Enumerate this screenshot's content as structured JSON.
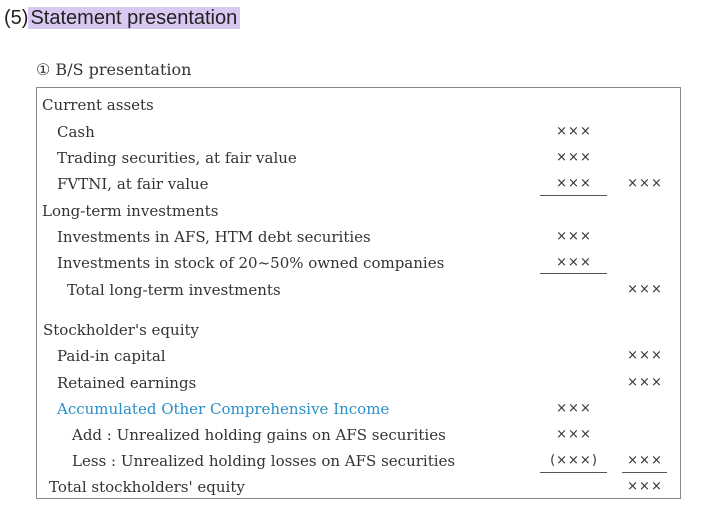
{
  "section": {
    "number": "(5)",
    "title": "Statement presentation"
  },
  "subtitle": "① B/S presentation",
  "rows": [
    {
      "label": "Current assets",
      "indent": 0,
      "col1": "",
      "col2": ""
    },
    {
      "label": "Cash",
      "indent": 1,
      "col1": "×××",
      "col2": ""
    },
    {
      "label": "Trading securities, at fair value",
      "indent": 1,
      "col1": "×××",
      "col2": ""
    },
    {
      "label": "FVTNI, at fair value",
      "indent": 1,
      "col1": "×××",
      "col2": "×××"
    },
    {
      "label": "Long-term investments",
      "indent": 0,
      "col1": "",
      "col2": ""
    },
    {
      "label": "Investments in AFS, HTM debt securities",
      "indent": 1,
      "col1": "×××",
      "col2": ""
    },
    {
      "label": "Investments in stock of 20~50% owned companies",
      "indent": 1,
      "col1": "×××",
      "col2": ""
    },
    {
      "label": "Total long-term investments",
      "indent": 2,
      "col1": "",
      "col2": "×××"
    },
    {
      "label": "Stockholder's equity",
      "indent": 0,
      "col1": "",
      "col2": ""
    },
    {
      "label": "Paid-in capital",
      "indent": 1,
      "col1": "",
      "col2": "×××"
    },
    {
      "label": "Retained earnings",
      "indent": 1,
      "col1": "",
      "col2": "×××"
    },
    {
      "label": "Accumulated Other Comprehensive Income",
      "indent": 1,
      "col1": "×××",
      "col2": "",
      "accent": true
    },
    {
      "label": "Add : Unrealized holding gains on AFS securities",
      "indent": 3,
      "col1": "×××",
      "col2": ""
    },
    {
      "label": "Less : Unrealized holding losses on AFS securities",
      "indent": 3,
      "col1": "(×××)",
      "col2": "×××"
    },
    {
      "label": "Total stockholders' equity",
      "indent": 4,
      "col1": "",
      "col2": "×××"
    }
  ],
  "colors": {
    "accent": "#2a8fc8",
    "highlight": "#d9c8f2"
  }
}
